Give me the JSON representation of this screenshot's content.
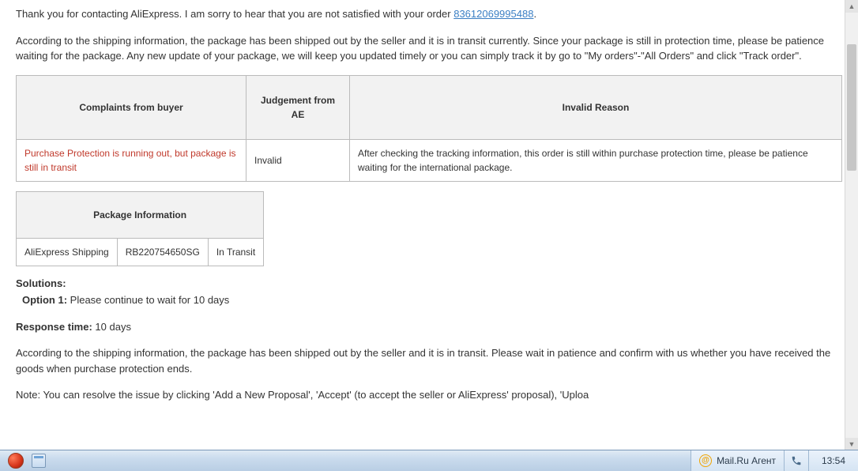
{
  "message": {
    "intro_pre": "Thank you for contacting AliExpress. I am sorry to hear that you are not satisfied with your order ",
    "order_number": "83612069995488",
    "intro_post": ".",
    "para2": "According to the shipping information, the package has been shipped out by the seller and it is in transit currently. Since your package is still in protection time, please be patience waiting for the package. Any new update of your package, we will keep you updated timely or you can simply track it by go to \"My orders\"-\"All Orders\" and click \"Track order\"."
  },
  "complaint_table": {
    "headers": {
      "col1": "Complaints from buyer",
      "col2": "Judgement from AE",
      "col3": "Invalid Reason"
    },
    "row": {
      "complaint": "Purchase Protection is running out, but package is still in transit",
      "judgement": "Invalid",
      "reason": "After checking the tracking information, this order is still within purchase protection time, please be patience waiting for the international package."
    }
  },
  "package_table": {
    "header": "Package Information",
    "row": {
      "carrier": "AliExpress Shipping",
      "tracking": "RB220754650SG",
      "status": "In Transit"
    }
  },
  "solutions": {
    "label": "Solutions:",
    "option1_label": "Option 1:",
    "option1_text": " Please continue to wait for 10 days"
  },
  "response_time": {
    "label": "Response time:",
    "value": " 10 days"
  },
  "para3": "According to the shipping information, the package has been shipped out by the seller and it is in transit. Please wait in patience and confirm with us whether you have received the goods when purchase protection ends.",
  "note": "Note: You can resolve the issue by clicking 'Add a New Proposal', 'Accept' (to accept the seller or AliExpress' proposal), 'Uploa",
  "taskbar": {
    "mail_agent": "Mail.Ru Агент",
    "clock": "13:54"
  }
}
